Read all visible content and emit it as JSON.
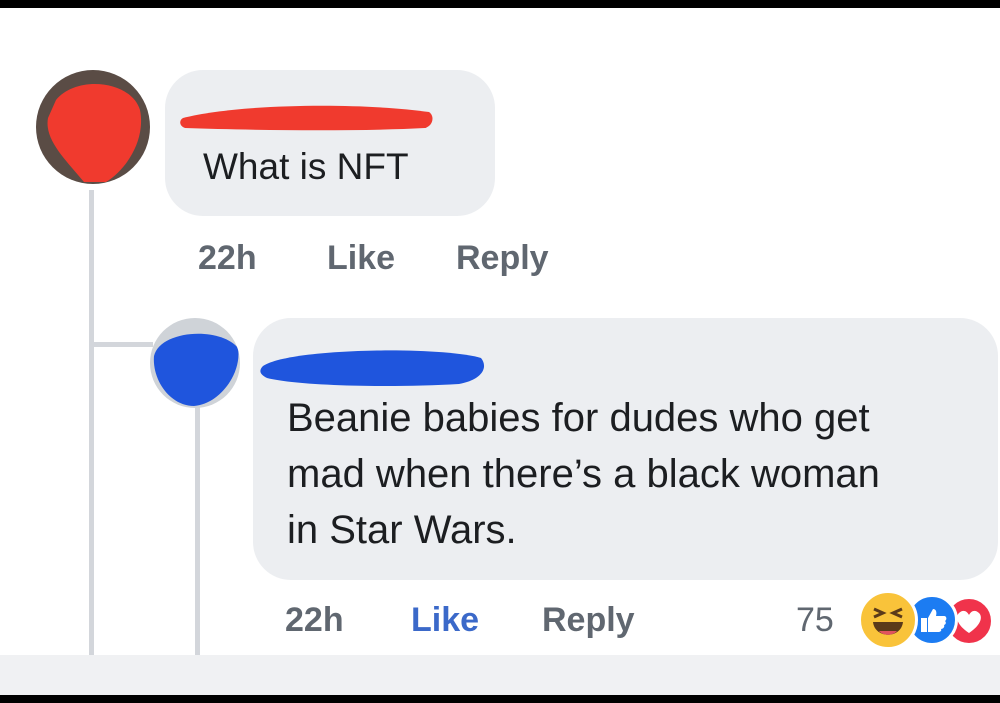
{
  "comment": {
    "text": "What is NFT",
    "time": "22h",
    "like_label": "Like",
    "reply_label": "Reply",
    "colors": {
      "redaction": "#f03a2e"
    }
  },
  "reply": {
    "text_lines": [
      "Beanie babies for dudes who get",
      "mad when there’s a black woman",
      "in Star Wars."
    ],
    "time": "22h",
    "like_label": "Like",
    "reply_label": "Reply",
    "reaction_count": "75",
    "reactions": [
      "haha-icon",
      "like-icon",
      "love-icon"
    ],
    "colors": {
      "redaction": "#1f55dd",
      "liked": "#3b69c9"
    }
  }
}
